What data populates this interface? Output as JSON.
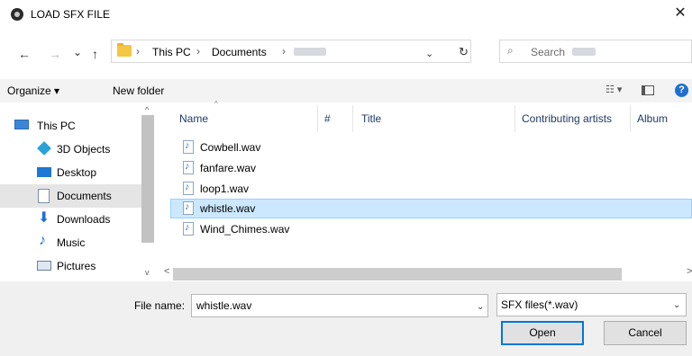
{
  "window": {
    "title": "LOAD SFX FILE",
    "close_label": "✕"
  },
  "nav": {
    "back": "←",
    "forward": "→",
    "recent": "⌄",
    "up": "↑",
    "breadcrumb": [
      "This PC",
      "Documents"
    ],
    "separator": "›",
    "dropdown": "⌄",
    "refresh": "↻",
    "search_placeholder": "Search",
    "search_glyph": "⌕"
  },
  "toolbar": {
    "organize": "Organize ▾",
    "new_folder": "New folder",
    "view_glyph": "☷ ▾",
    "help": "?"
  },
  "sidebar": {
    "items": [
      {
        "label": "This PC",
        "icon": "pc-icon",
        "selected": false
      },
      {
        "label": "3D Objects",
        "icon": "cube-icon",
        "selected": false
      },
      {
        "label": "Desktop",
        "icon": "desktop-icon",
        "selected": false
      },
      {
        "label": "Documents",
        "icon": "documents-icon",
        "selected": true
      },
      {
        "label": "Downloads",
        "icon": "download-icon",
        "selected": false
      },
      {
        "label": "Music",
        "icon": "music-icon",
        "selected": false
      },
      {
        "label": "Pictures",
        "icon": "pictures-icon",
        "selected": false
      }
    ]
  },
  "files": {
    "columns": [
      "Name",
      "#",
      "Title",
      "Contributing artists",
      "Album"
    ],
    "rows": [
      {
        "name": "Cowbell.wav",
        "selected": false
      },
      {
        "name": "fanfare.wav",
        "selected": false
      },
      {
        "name": "loop1.wav",
        "selected": false
      },
      {
        "name": "whistle.wav",
        "selected": true
      },
      {
        "name": "Wind_Chimes.wav",
        "selected": false
      }
    ]
  },
  "scroll": {
    "up": "^",
    "down": "v",
    "left": "<",
    "right": ">",
    "sort": "^"
  },
  "bottom": {
    "file_name_label": "File name:",
    "file_name_value": "whistle.wav",
    "filter": "SFX files(*.wav)",
    "open": "Open",
    "cancel": "Cancel",
    "dropdown": "⌄"
  },
  "colors": {
    "selection_bg": "#cce8ff",
    "selection_border": "#99d1ff",
    "accent": "#0078d7",
    "folder": "#f3c744"
  }
}
